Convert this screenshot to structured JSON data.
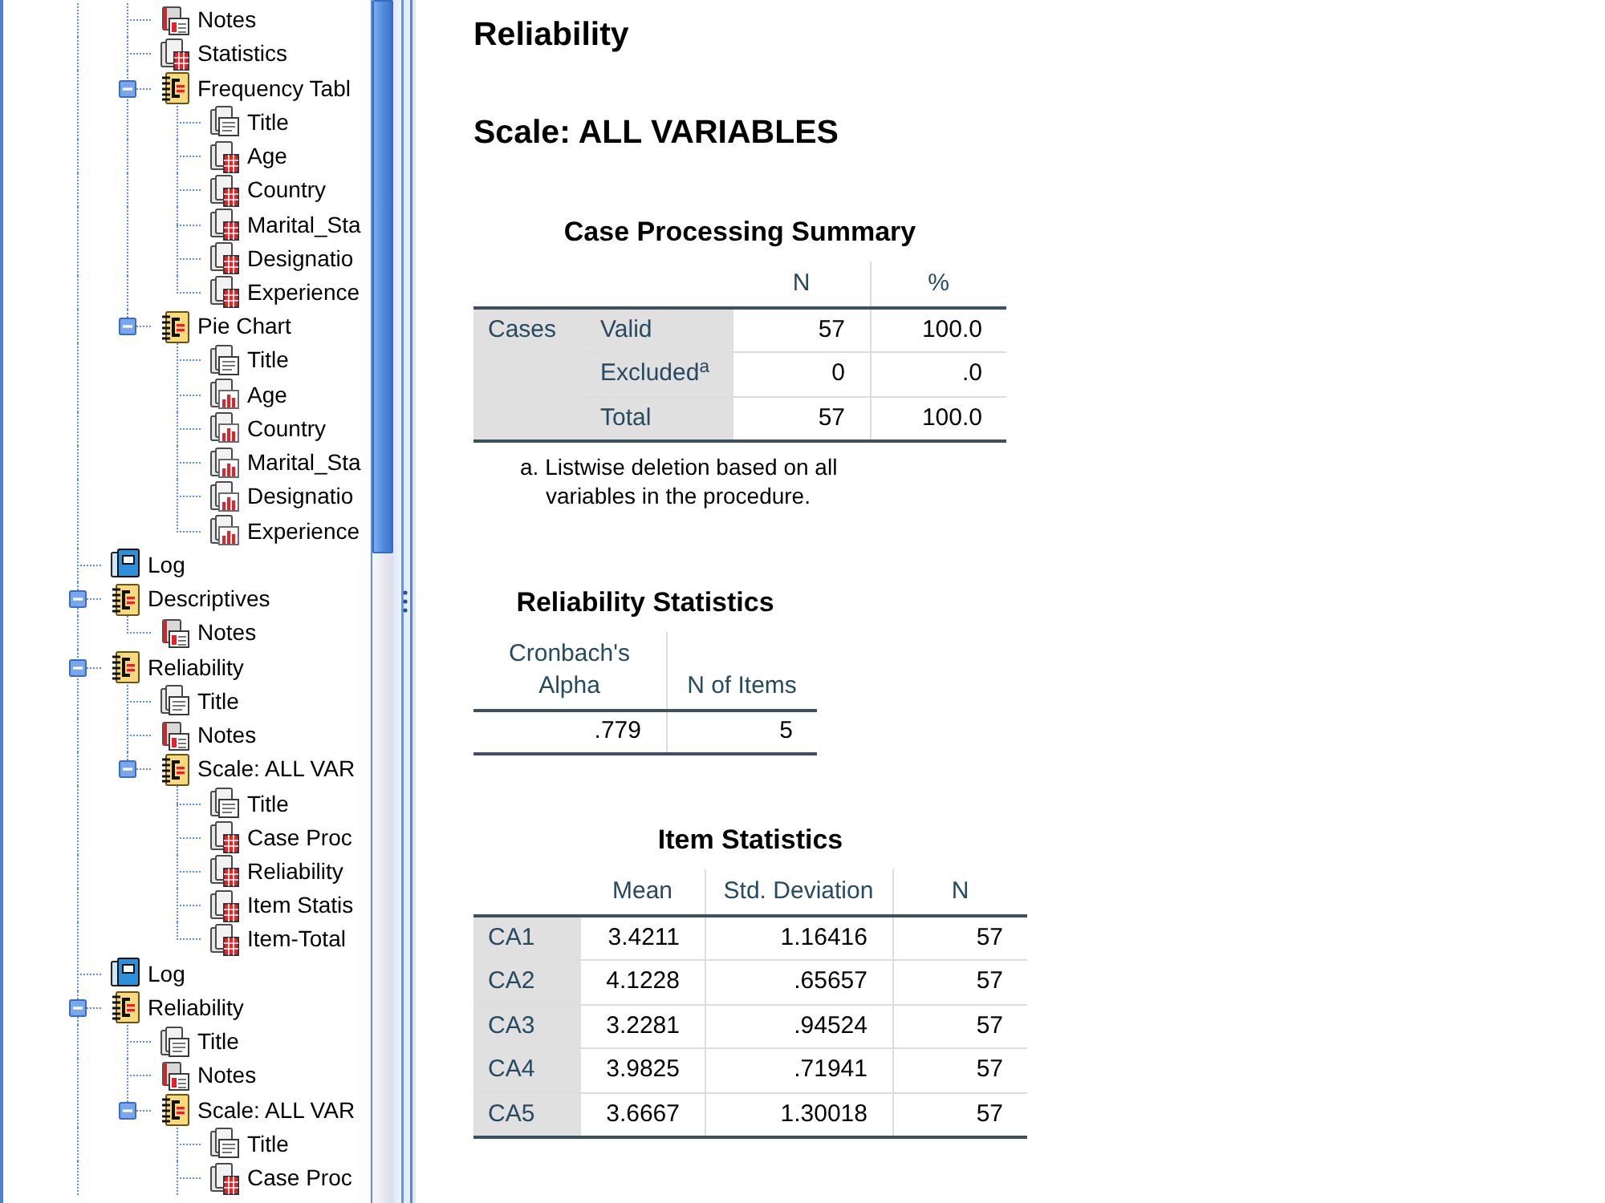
{
  "outline": {
    "items": [
      {
        "children": [
          {
            "label": "Notes",
            "kind": "notes"
          },
          {
            "label": "Statistics",
            "kind": "table"
          },
          {
            "label": "Frequency Tabl",
            "kind": "heading",
            "expanded": true,
            "children": [
              {
                "label": "Title",
                "kind": "title"
              },
              {
                "label": "Age",
                "kind": "table"
              },
              {
                "label": "Country",
                "kind": "table"
              },
              {
                "label": "Marital_Sta",
                "kind": "table"
              },
              {
                "label": "Designatio",
                "kind": "table"
              },
              {
                "label": "Experience",
                "kind": "table"
              }
            ]
          },
          {
            "label": "Pie Chart",
            "kind": "heading",
            "expanded": true,
            "children": [
              {
                "label": "Title",
                "kind": "title"
              },
              {
                "label": "Age",
                "kind": "chart"
              },
              {
                "label": "Country",
                "kind": "chart"
              },
              {
                "label": "Marital_Sta",
                "kind": "chart"
              },
              {
                "label": "Designatio",
                "kind": "chart"
              },
              {
                "label": "Experience",
                "kind": "chart"
              }
            ]
          }
        ]
      },
      {
        "label": "Log",
        "kind": "log"
      },
      {
        "label": "Descriptives",
        "kind": "heading",
        "expanded": true,
        "children": [
          {
            "label": "Notes",
            "kind": "notes"
          }
        ]
      },
      {
        "label": "Reliability",
        "kind": "heading",
        "expanded": true,
        "children": [
          {
            "label": "Title",
            "kind": "title"
          },
          {
            "label": "Notes",
            "kind": "notes"
          },
          {
            "label": "Scale: ALL VAR",
            "kind": "heading",
            "expanded": true,
            "children": [
              {
                "label": "Title",
                "kind": "title"
              },
              {
                "label": "Case Proc",
                "kind": "table"
              },
              {
                "label": "Reliability",
                "kind": "table"
              },
              {
                "label": "Item Statis",
                "kind": "table"
              },
              {
                "label": "Item-Total",
                "kind": "table"
              }
            ]
          }
        ]
      },
      {
        "label": "Log",
        "kind": "log"
      },
      {
        "label": "Reliability",
        "kind": "heading",
        "expanded": true,
        "children": [
          {
            "label": "Title",
            "kind": "title"
          },
          {
            "label": "Notes",
            "kind": "notes"
          },
          {
            "label": "Scale: ALL VAR",
            "kind": "heading",
            "expanded": true,
            "children": [
              {
                "label": "Title",
                "kind": "title"
              },
              {
                "label": "Case Proc",
                "kind": "table"
              }
            ]
          }
        ]
      }
    ]
  },
  "output": {
    "title": "Reliability",
    "subtitle": "Scale: ALL VARIABLES",
    "case_processing_summary": {
      "title": "Case Processing Summary",
      "columns": [
        "N",
        "%"
      ],
      "group": "Cases",
      "rows": [
        {
          "label": "Valid",
          "values": [
            "57",
            "100.0"
          ]
        },
        {
          "label": "Excluded$^{a}$",
          "values": [
            "0",
            ".0"
          ]
        },
        {
          "label": "Total",
          "values": [
            "57",
            "100.0"
          ]
        }
      ],
      "footnote": "a. Listwise deletion based on all variables in the procedure."
    },
    "reliability_statistics": {
      "title": "Reliability Statistics",
      "columns": [
        "Cronbach's Alpha",
        "N of Items"
      ],
      "rows": [
        [
          ".779",
          "5"
        ]
      ]
    },
    "item_statistics": {
      "title": "Item Statistics",
      "columns": [
        "Mean",
        "Std. Deviation",
        "N"
      ],
      "rows": [
        {
          "label": "CA1",
          "values": [
            "3.4211",
            "1.16416",
            "57"
          ]
        },
        {
          "label": "CA2",
          "values": [
            "4.1228",
            ".65657",
            "57"
          ]
        },
        {
          "label": "CA3",
          "values": [
            "3.2281",
            ".94524",
            "57"
          ]
        },
        {
          "label": "CA4",
          "values": [
            "3.9825",
            ".71941",
            "57"
          ]
        },
        {
          "label": "CA5",
          "values": [
            "3.6667",
            "1.30018",
            "57"
          ]
        }
      ]
    }
  }
}
